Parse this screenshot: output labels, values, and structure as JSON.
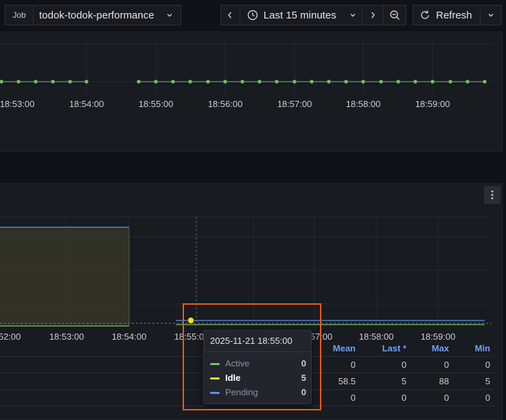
{
  "toolbar": {
    "job_label": "Job",
    "job_value": "todok-todok-performance",
    "time_range": "Last 15 minutes",
    "refresh_label": "Refresh"
  },
  "top_panel": {
    "x_ticks": [
      "18:53:00",
      "18:54:00",
      "18:55:00",
      "18:56:00",
      "18:57:00",
      "18:58:00",
      "18:59:00"
    ]
  },
  "bottom_panel": {
    "x_ticks": [
      "52:00",
      "18:53:00",
      "18:54:00",
      "18:55:00",
      "57:00",
      "18:58:00",
      "18:59:00"
    ],
    "legend_table": {
      "columns": [
        "Mean",
        "Last *",
        "Max",
        "Min"
      ],
      "rows": [
        {
          "series": "Active",
          "values": [
            "0",
            "0",
            "0",
            "0"
          ]
        },
        {
          "series": "Idle",
          "values": [
            "58.5",
            "5",
            "88",
            "5"
          ]
        },
        {
          "series": "Pending",
          "values": [
            "0",
            "0",
            "0",
            "0"
          ]
        }
      ]
    }
  },
  "tooltip": {
    "time": "2025-11-21 18:55:00",
    "items": [
      {
        "label": "Active",
        "value": "0",
        "color": "#73bf69"
      },
      {
        "label": "Idle",
        "value": "5",
        "color": "#fade2a"
      },
      {
        "label": "Pending",
        "value": "0",
        "color": "#5794f2"
      }
    ]
  },
  "colors": {
    "active": "#73bf69",
    "idle": "#fade2a",
    "pending": "#5794f2",
    "highlight": "#f05a1a",
    "header_link": "#6e9fff"
  },
  "icons": [
    "chevron-down-icon",
    "chevron-left-icon",
    "chevron-right-icon",
    "clock-icon",
    "zoom-out-icon",
    "refresh-icon",
    "more-vertical-icon"
  ]
}
